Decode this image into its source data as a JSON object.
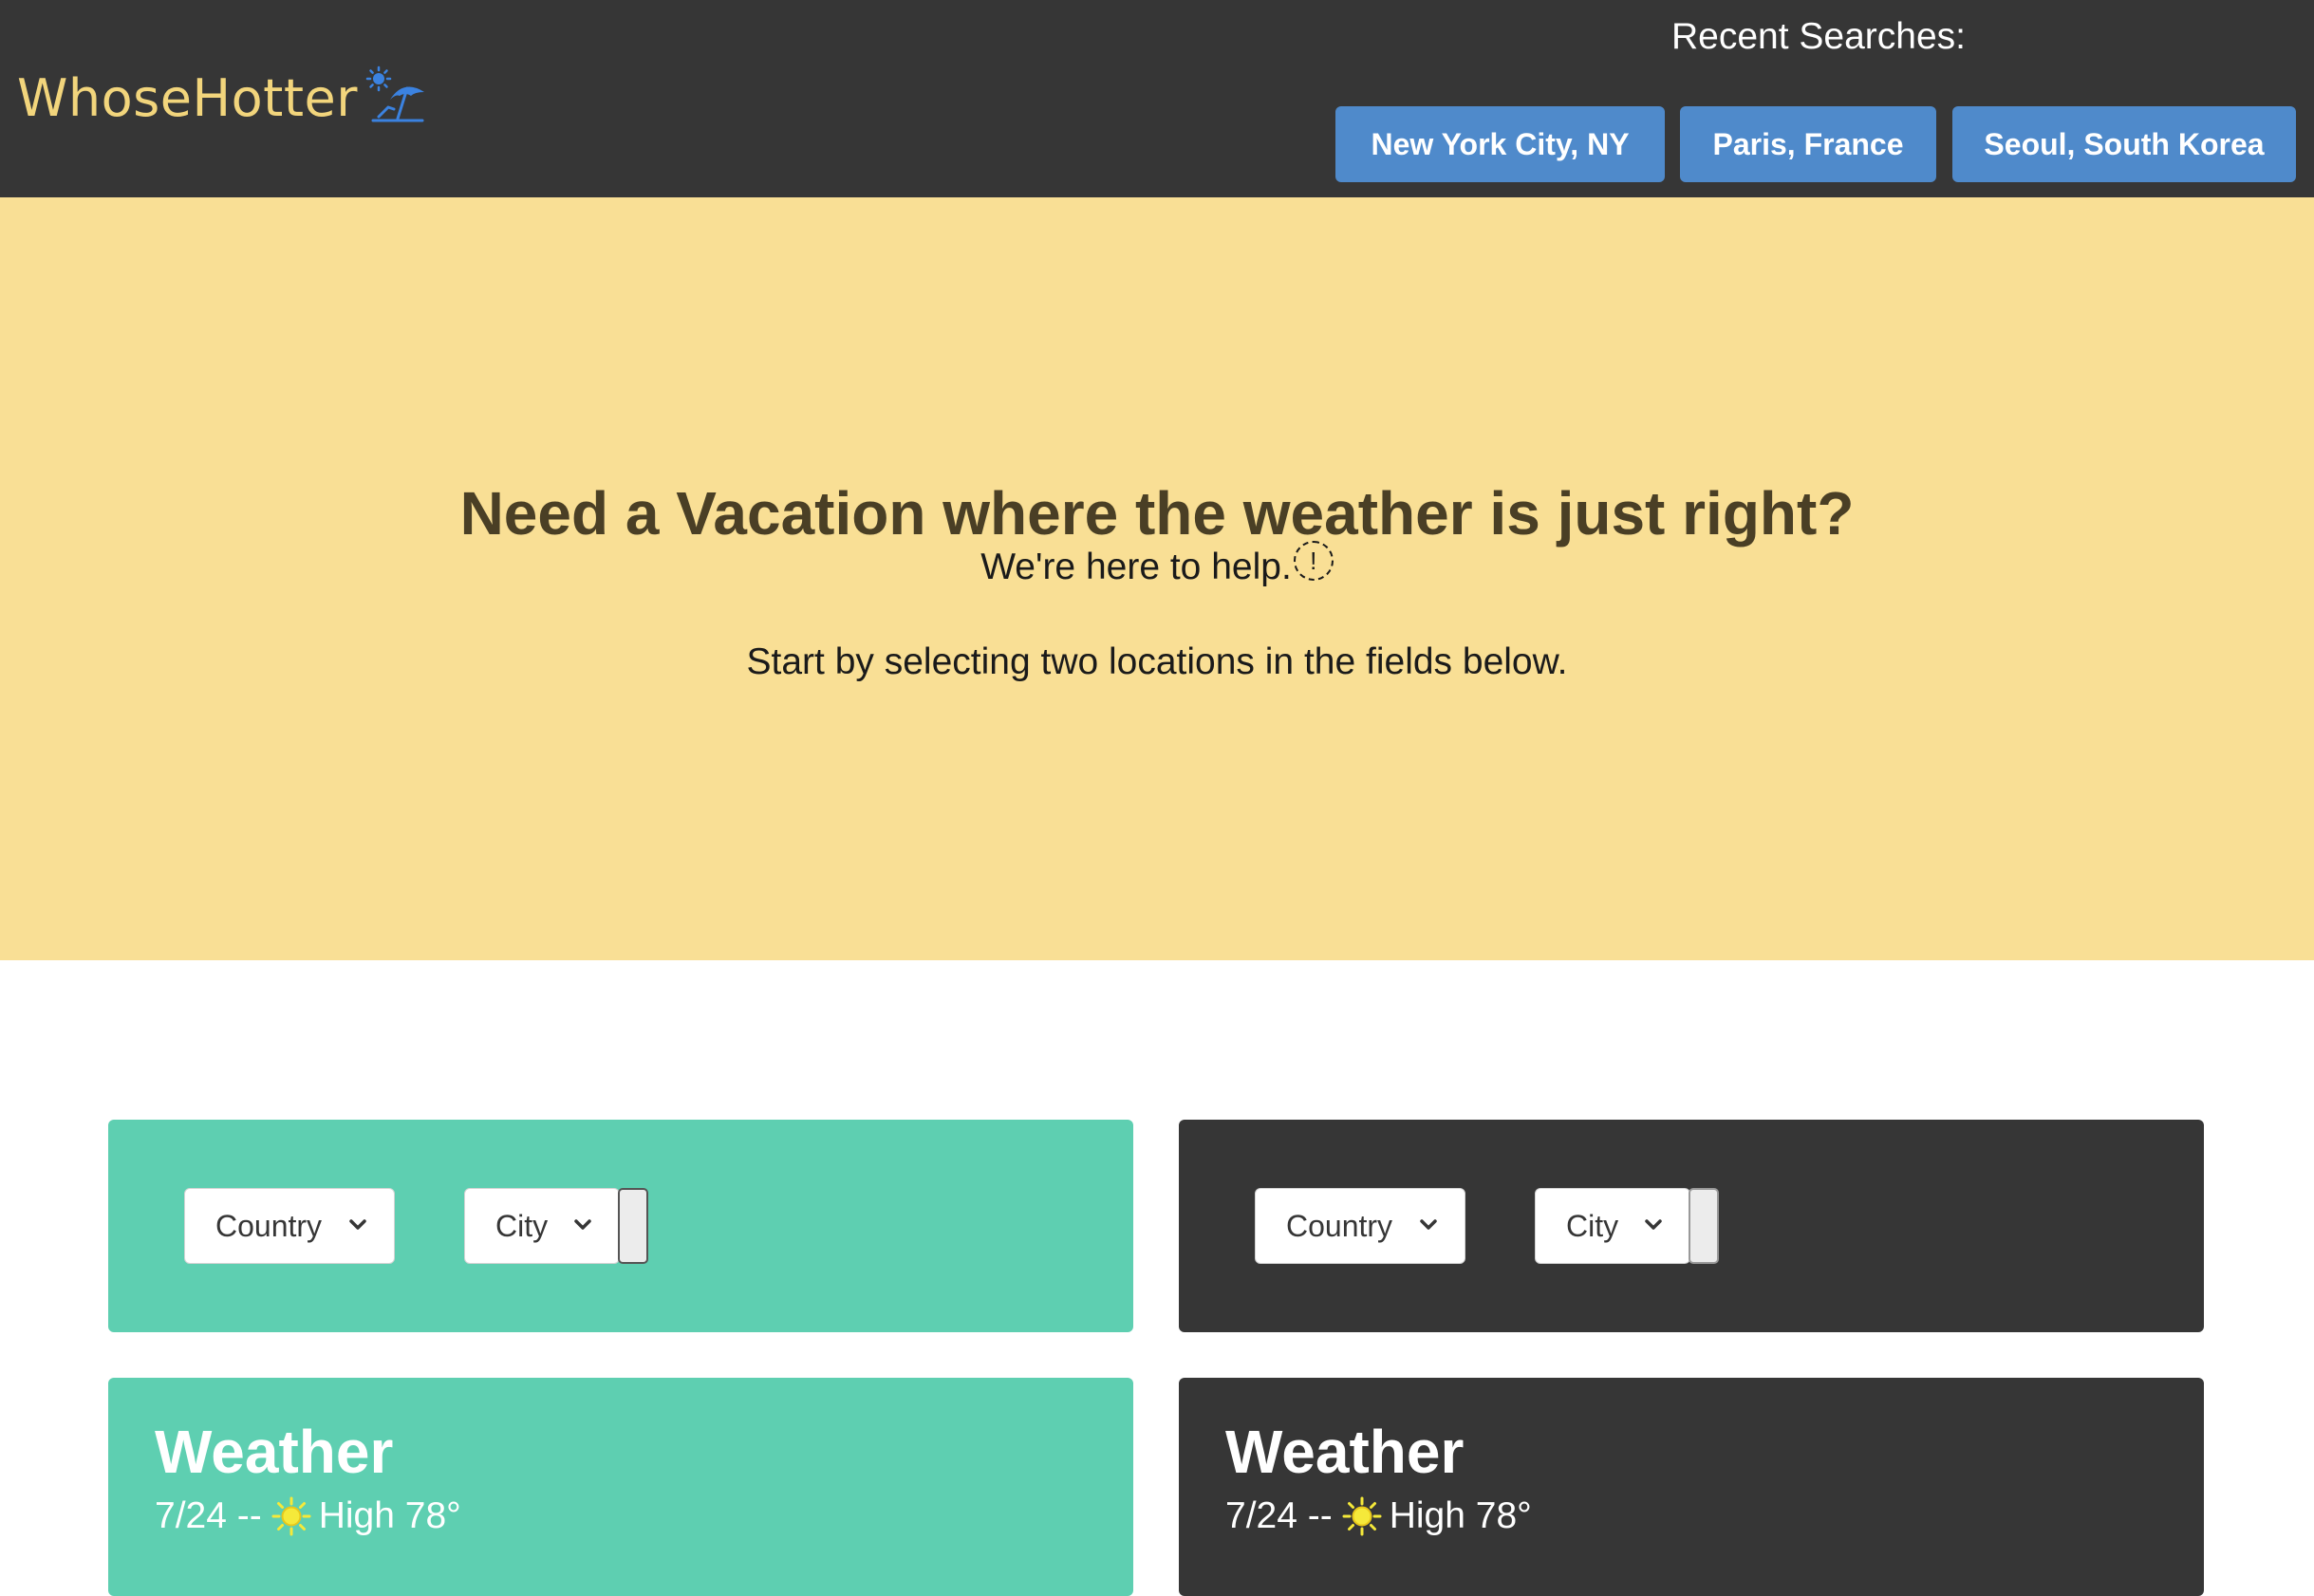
{
  "header": {
    "brand": "WhoseHotter",
    "recent_label": "Recent Searches:",
    "recent_searches": [
      "New York City, NY",
      "Paris, France",
      "Seoul, South Korea"
    ]
  },
  "hero": {
    "title": "Need a Vacation where the weather is just right?",
    "subtitle": "We're here to help.",
    "info_glyph": "!",
    "description": "Start by selecting two locations in the fields below."
  },
  "selectors": [
    {
      "country_value": "Country",
      "city_value": "City"
    },
    {
      "country_value": "Country",
      "city_value": "City"
    }
  ],
  "weather": [
    {
      "title": "Weather",
      "date": "7/24 --",
      "high": "High 78°",
      "icon": "sun-icon"
    },
    {
      "title": "Weather",
      "date": "7/24 --",
      "high": "High 78°",
      "icon": "sun-icon"
    }
  ],
  "colors": {
    "header_bg": "#363636",
    "brand": "#f2d57c",
    "recent_button": "#4f8acb",
    "hero_bg": "#f9df95",
    "teal": "#5ecfb1",
    "dark": "#363636",
    "sun": "#f5e93a"
  }
}
